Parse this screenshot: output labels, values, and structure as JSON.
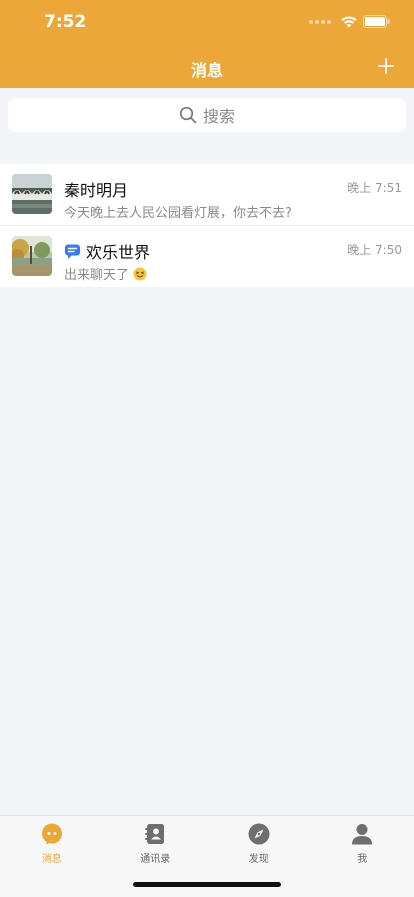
{
  "status_bar": {
    "time": "7:52"
  },
  "header": {
    "title": "消息",
    "add_icon": "plus-icon"
  },
  "search": {
    "placeholder": "搜索",
    "icon": "search-icon"
  },
  "conversations": [
    {
      "name": "秦时明月",
      "time": "晚上 7:51",
      "last_message": "今天晚上去人民公园看灯展，你去不去?",
      "type": "single"
    },
    {
      "name": "欢乐世界",
      "time": "晚上 7:50",
      "last_message": "出来聊天了",
      "type": "group",
      "emoji": "tongue-out-emoji"
    }
  ],
  "tabs": [
    {
      "label": "消息",
      "icon": "chat-bubble-icon",
      "active": true
    },
    {
      "label": "通讯录",
      "icon": "contacts-icon",
      "active": false
    },
    {
      "label": "发现",
      "icon": "compass-icon",
      "active": false
    },
    {
      "label": "我",
      "icon": "person-icon",
      "active": false
    }
  ],
  "colors": {
    "accent": "#eca738",
    "background": "#f3f4f8",
    "group_badge": "#3a7bf0"
  }
}
